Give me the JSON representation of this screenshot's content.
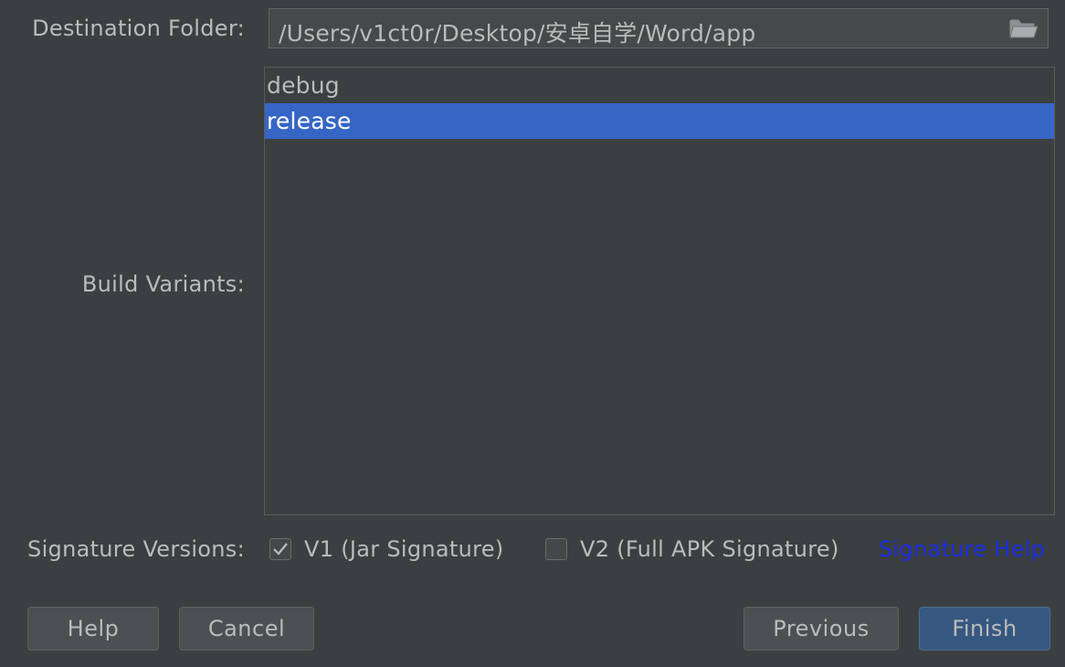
{
  "dialog": {
    "destination": {
      "label": "Destination Folder:",
      "value": "/Users/v1ct0r/Desktop/安卓自学/Word/app",
      "browse_icon": "folder-open-icon"
    },
    "build_variants": {
      "label": "Build Variants:",
      "items": [
        {
          "label": "debug",
          "selected": false
        },
        {
          "label": "release",
          "selected": true
        }
      ]
    },
    "signature_versions": {
      "label": "Signature Versions:",
      "v1": {
        "label": "V1 (Jar Signature)",
        "checked": true
      },
      "v2": {
        "label": "V2 (Full APK Signature)",
        "checked": false
      },
      "help_link": "Signature Help"
    },
    "buttons": {
      "help": "Help",
      "cancel": "Cancel",
      "previous": "Previous",
      "finish": "Finish"
    }
  },
  "colors": {
    "background": "#3c3f41",
    "selection": "#3566c6",
    "link": "#1a2ee0",
    "default_button": "#365880"
  }
}
